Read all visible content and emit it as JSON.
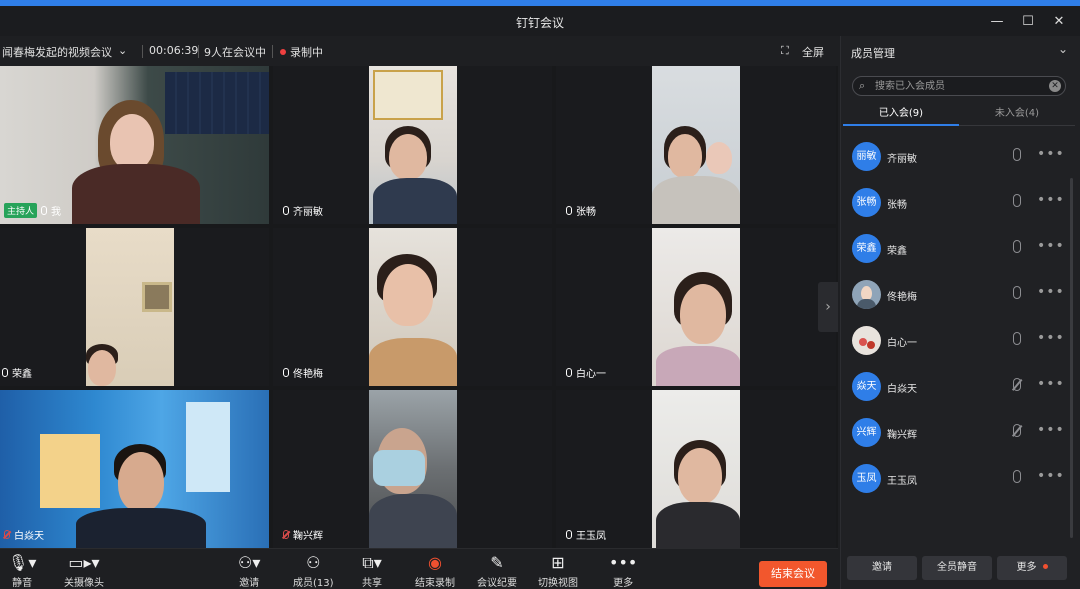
{
  "window": {
    "title": "钉钉会议"
  },
  "infobar": {
    "meeting_title": "闻春梅发起的视频会议",
    "duration": "00:06:39",
    "participants_in": "9人在会议中",
    "recording": "录制中",
    "fullscreen": "全屏"
  },
  "tiles": [
    {
      "name": "我",
      "host_badge": "主持人",
      "muted": false
    },
    {
      "name": "齐丽敏",
      "muted": false
    },
    {
      "name": "张畅",
      "muted": false
    },
    {
      "name": "荣鑫",
      "muted": false
    },
    {
      "name": "佟艳梅",
      "muted": false
    },
    {
      "name": "白心一",
      "muted": false
    },
    {
      "name": "白焱天",
      "muted": true
    },
    {
      "name": "鞠兴辉",
      "muted": true
    },
    {
      "name": "王玉凤",
      "muted": false
    }
  ],
  "toolbar": {
    "mute": "静音",
    "camera_off": "关摄像头",
    "invite": "邀请",
    "members": "成员(13)",
    "share": "共享",
    "end_recording": "结束录制",
    "minutes": "会议纪要",
    "switch_view": "切换视图",
    "more": "更多",
    "end_meeting": "结束会议"
  },
  "panel": {
    "title": "成员管理",
    "search_placeholder": "搜索已入会成员",
    "tab_joined": "已入会(9)",
    "tab_not_joined": "未入会(4)",
    "members": [
      {
        "avatar": "丽敏",
        "name": "齐丽敏",
        "muted": false
      },
      {
        "avatar": "张畅",
        "name": "张畅",
        "muted": false
      },
      {
        "avatar": "荣鑫",
        "name": "荣鑫",
        "muted": false
      },
      {
        "avatar": "",
        "name": "佟艳梅",
        "muted": false
      },
      {
        "avatar": "",
        "name": "白心一",
        "muted": false
      },
      {
        "avatar": "焱天",
        "name": "白焱天",
        "muted": true
      },
      {
        "avatar": "兴辉",
        "name": "鞠兴辉",
        "muted": true
      },
      {
        "avatar": "玉凤",
        "name": "王玉凤",
        "muted": false
      }
    ],
    "invite_btn": "邀请",
    "mute_all_btn": "全员静音",
    "more_btn": "更多"
  },
  "colors": {
    "accent": "#2f7ee8",
    "end": "#f2572d",
    "host": "#27a35a",
    "record": "#f04040"
  }
}
